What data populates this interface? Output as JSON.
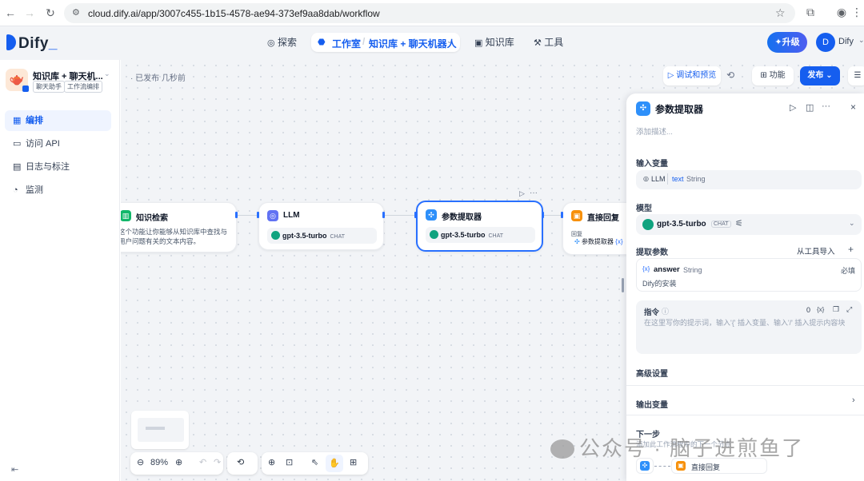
{
  "browser": {
    "url": "cloud.dify.ai/app/3007c455-1b15-4578-ae94-373ef9aa8dab/workflow"
  },
  "header": {
    "logo": "Dify",
    "nav": {
      "explore": "探索",
      "studio": "工作室",
      "app_name": "知识库 + 聊天机器人",
      "knowledge": "知识库",
      "tools": "工具"
    },
    "upgrade": "升级",
    "avatar_letter": "D",
    "user_name": "Dify"
  },
  "sidebar": {
    "app_title": "知识库 + 聊天机...",
    "tags": [
      "聊天助手",
      "工作流编排"
    ],
    "items": [
      {
        "label": "编排",
        "icon": "layout-icon",
        "active": true
      },
      {
        "label": "访问 API",
        "icon": "terminal-icon"
      },
      {
        "label": "日志与标注",
        "icon": "file-icon"
      },
      {
        "label": "监测",
        "icon": "monitor-icon"
      }
    ]
  },
  "canvas": {
    "status": "· 已发布 几秒前",
    "actions": {
      "debug": "调试和预览",
      "features": "功能",
      "publish": "发布"
    },
    "nodes": [
      {
        "title": "知识检索",
        "desc": "这个功能让你能够从知识库中查找与用户问题有关的文本内容。",
        "icon_color": "#12b76a"
      },
      {
        "title": "LLM",
        "model": "gpt-3.5-turbo",
        "mode": "CHAT",
        "icon_color": "#6172f3"
      },
      {
        "title": "参数提取器",
        "model": "gpt-3.5-turbo",
        "mode": "CHAT",
        "icon_color": "#2e90fa"
      },
      {
        "title": "直接回复",
        "sub_label": "回复",
        "var": "参数提取器",
        "var_suffix": "{x}",
        "icon_color": "#f79009"
      }
    ],
    "toolbar": {
      "zoom": "89%"
    }
  },
  "panel": {
    "title": "参数提取器",
    "description_placeholder": "添加描述...",
    "input_var_label": "输入变量",
    "input_var": {
      "node": "LLM",
      "name": "text",
      "type": "String"
    },
    "model_label": "模型",
    "model": {
      "name": "gpt-3.5-turbo",
      "mode": "CHAT"
    },
    "extract_label": "提取参数",
    "import_tool": "从工具导入",
    "param": {
      "name": "answer",
      "type": "String",
      "required": "必填",
      "desc": "Dify的安装"
    },
    "instruction": {
      "label": "指令",
      "count": "0",
      "placeholder": "在这里写你的提示词，输入'{' 插入变量、输入'/' 插入提示内容块"
    },
    "advanced_label": "高级设置",
    "output_label": "输出变量",
    "next_label": "下一步",
    "next_desc": "添加此工作流程中的下一个节点",
    "next_node": "直接回复"
  },
  "watermark": "公众号 · 脑子进煎鱼了",
  "colors": {
    "accent": "#155eef",
    "selected_border": "#2970ff"
  }
}
